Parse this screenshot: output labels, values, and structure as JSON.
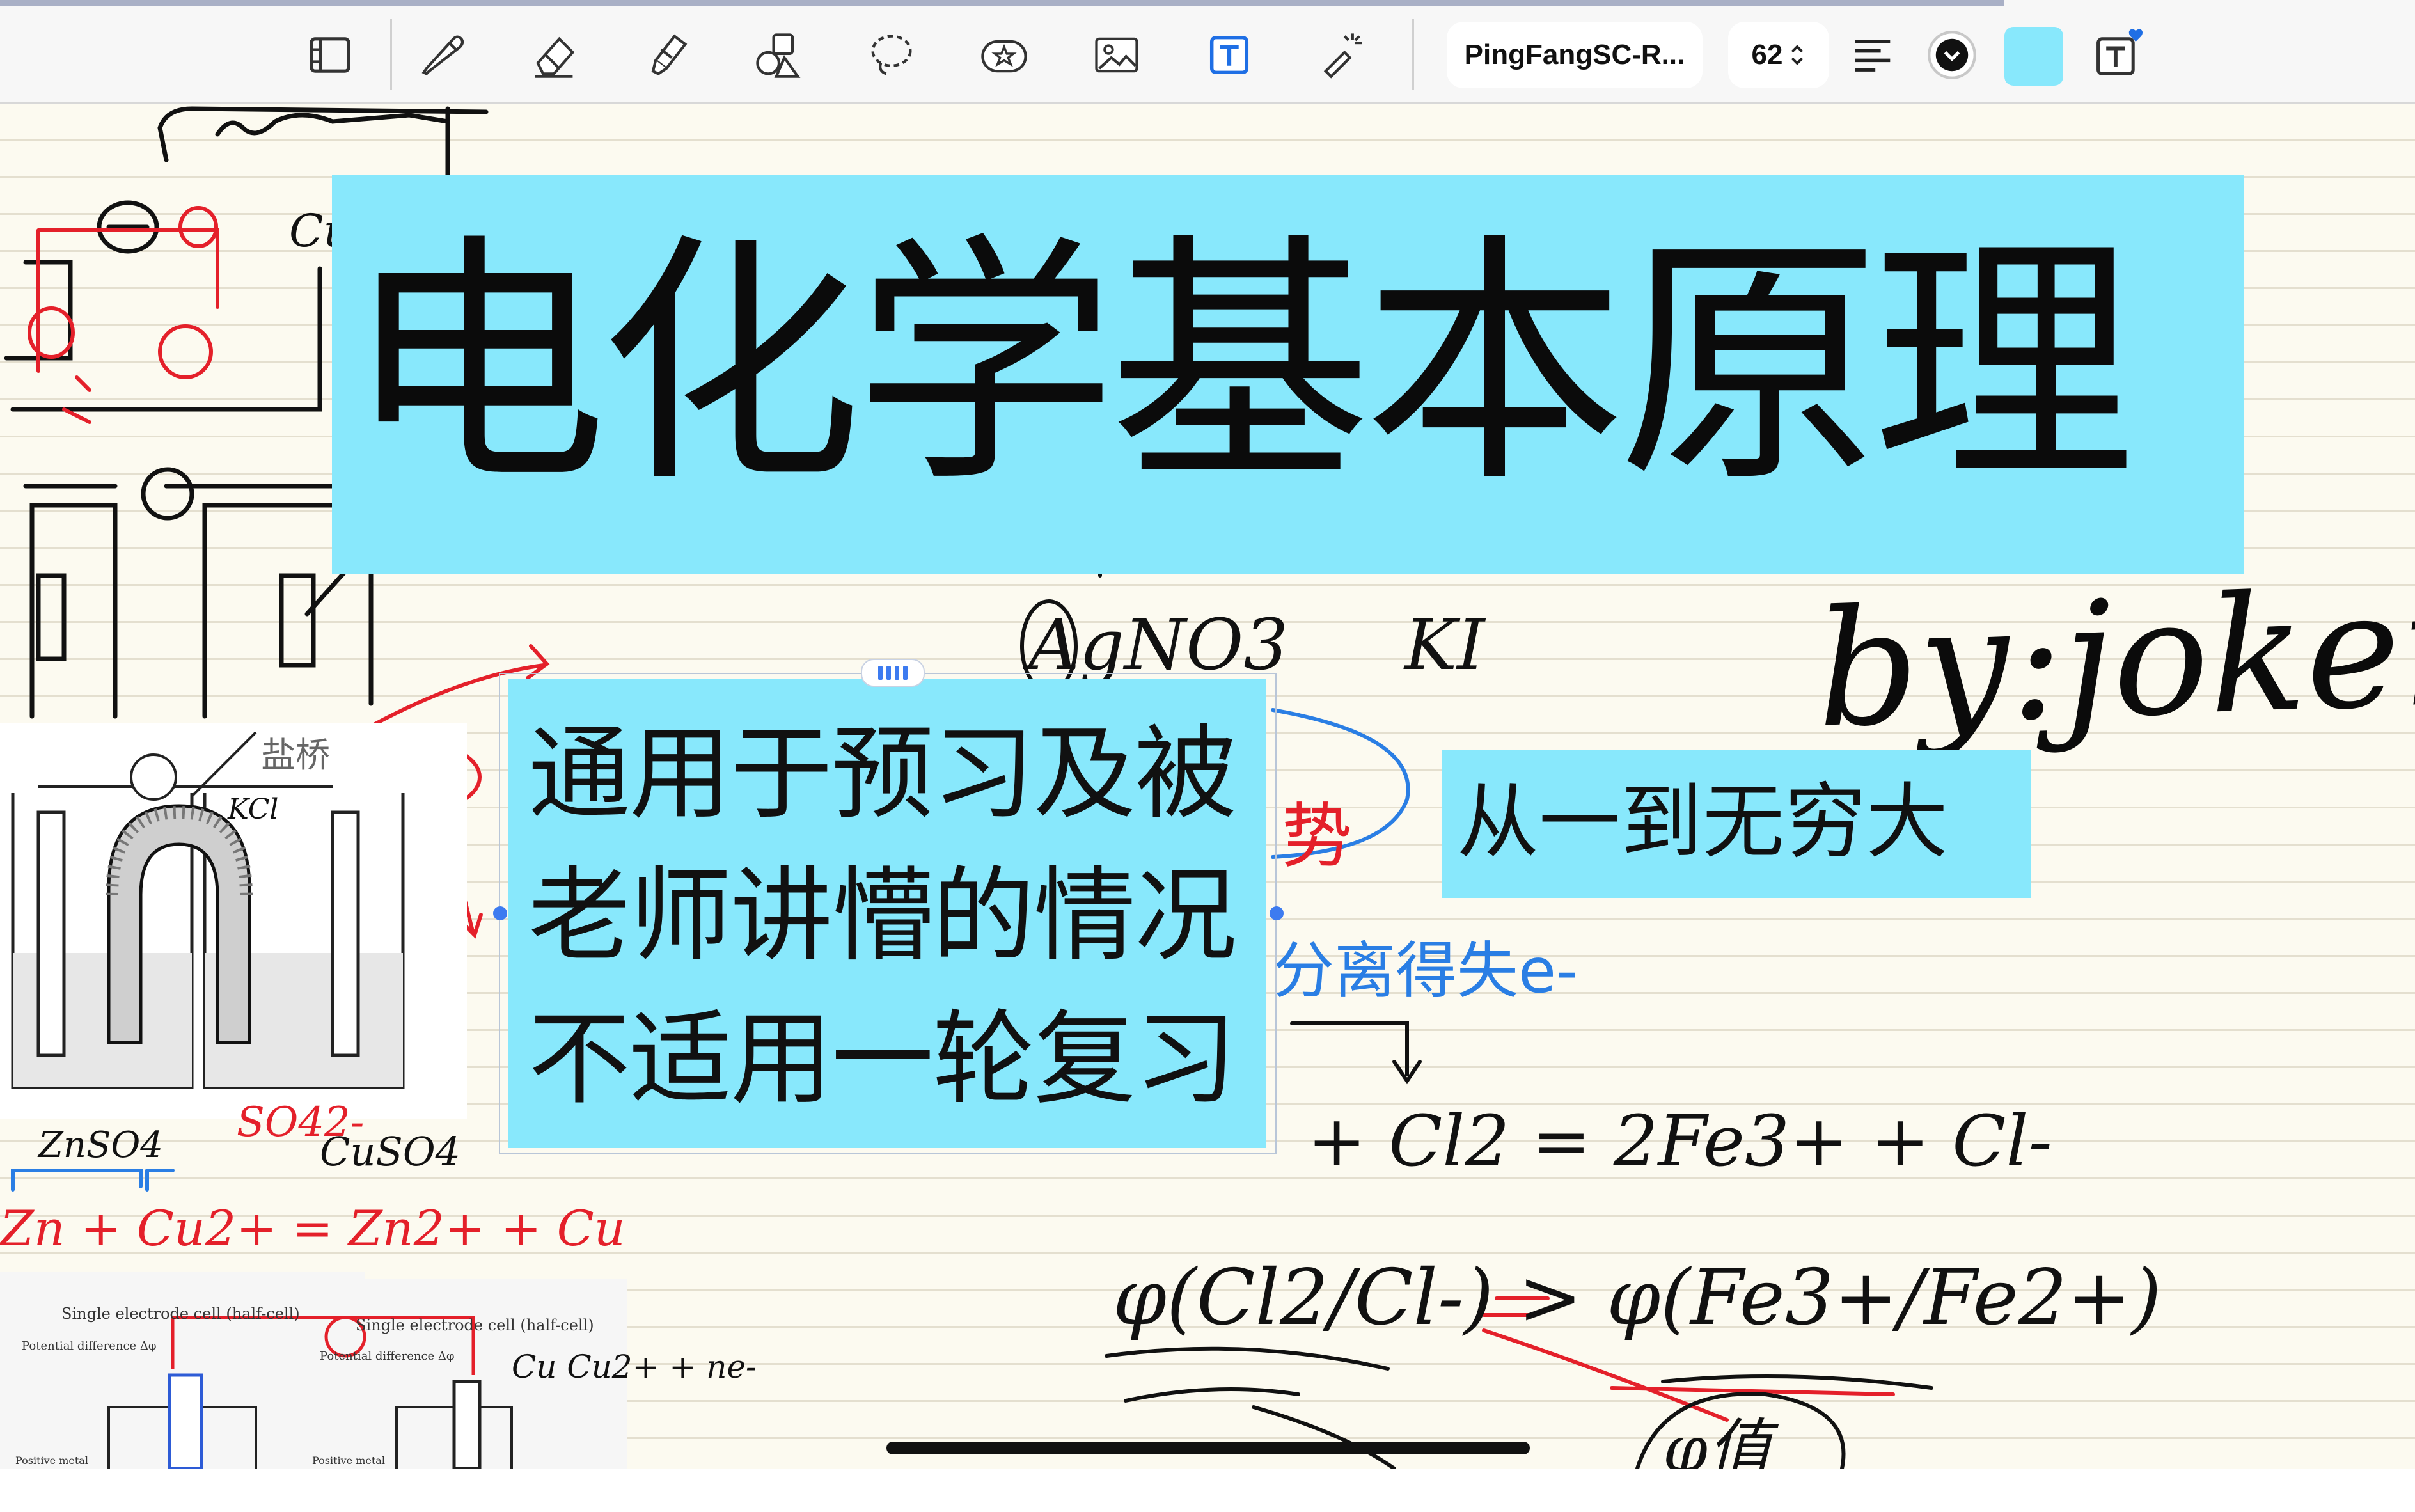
{
  "toolbar": {
    "tools": [
      {
        "name": "reader-mode-icon"
      },
      {
        "name": "pen-icon"
      },
      {
        "name": "eraser-icon"
      },
      {
        "name": "highlighter-icon"
      },
      {
        "name": "shapes-icon"
      },
      {
        "name": "lasso-icon"
      },
      {
        "name": "sticker-icon"
      },
      {
        "name": "image-icon"
      },
      {
        "name": "text-tool-icon"
      },
      {
        "name": "laser-pointer-icon"
      }
    ],
    "font_name": "PingFangSC-R...",
    "font_size": "62",
    "text_color": "#111111",
    "fill_color": "#88e8fc",
    "progress": 0.83
  },
  "note": {
    "title": "电化学基本原理",
    "author": "by:joker",
    "subtitle": "从一到无穷大",
    "notice_lines": [
      "通用于预习及被",
      "老师讲懵的情况",
      "不适用一轮复习"
    ],
    "accent_color": "#88e8fc"
  },
  "handwriting": {
    "agno3": "AgNO3",
    "ki": "KI",
    "cu_a": "Cu",
    "cu_b": "Cu",
    "cl2_eq": "+ Cl2 = 2Fe3+ + Cl-",
    "phi_eq": "φ(Cl2/Cl-) > φ(Fe3+/Fe2+)",
    "znso4": "ZnSO4",
    "cuso4": "CuSO4",
    "so4": "SO42-",
    "zn_eq": "Zn + Cu2+ = Zn2+ + Cu",
    "cu_eq": "Cu  Cu2+ + ne-",
    "salt_bridge": "盐桥",
    "kcl": "KCl",
    "fig_caption_a": "Single electrode cell (half-cell)",
    "fig_caption_b": "Single electrode cell (half-cell)",
    "potential_label_a": "Potential difference  Δφ",
    "potential_label_b": "Potential difference  Δφ",
    "positive_metal_a": "Positive metal",
    "positive_metal_b": "Positive metal",
    "blue_note": "分离得失e-",
    "red_note": "势",
    "phi_avg": "φ值"
  }
}
